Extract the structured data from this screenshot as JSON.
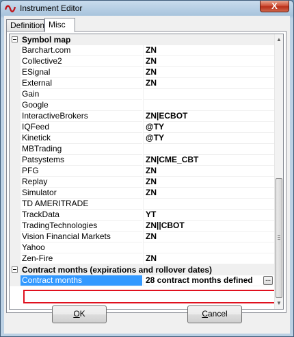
{
  "window": {
    "title": "Instrument Editor",
    "close_glyph": "X"
  },
  "tabs": [
    {
      "label": "Definition"
    },
    {
      "label": "Misc"
    }
  ],
  "categories": {
    "symbol_map": {
      "label": "Symbol map"
    },
    "contract_months": {
      "label": "Contract months (expirations and rollover dates)"
    }
  },
  "symbol_map": [
    {
      "name": "Barchart.com",
      "value": "ZN"
    },
    {
      "name": "Collective2",
      "value": "ZN"
    },
    {
      "name": "ESignal",
      "value": "ZN"
    },
    {
      "name": "External",
      "value": "ZN"
    },
    {
      "name": "Gain",
      "value": ""
    },
    {
      "name": "Google",
      "value": ""
    },
    {
      "name": "InteractiveBrokers",
      "value": "ZN|ECBOT"
    },
    {
      "name": "IQFeed",
      "value": "@TY"
    },
    {
      "name": "Kinetick",
      "value": "@TY"
    },
    {
      "name": "MBTrading",
      "value": ""
    },
    {
      "name": "Patsystems",
      "value": "ZN|CME_CBT"
    },
    {
      "name": "PFG",
      "value": "ZN"
    },
    {
      "name": "Replay",
      "value": "ZN"
    },
    {
      "name": "Simulator",
      "value": "ZN"
    },
    {
      "name": "TD AMERITRADE",
      "value": ""
    },
    {
      "name": "TrackData",
      "value": "YT"
    },
    {
      "name": "TradingTechnologies",
      "value": "ZN||CBOT"
    },
    {
      "name": "Vision Financial Markets",
      "value": "ZN"
    },
    {
      "name": "Yahoo",
      "value": ""
    },
    {
      "name": "Zen-Fire",
      "value": "ZN"
    }
  ],
  "contract_months": {
    "name": "Contract months",
    "value": "28 contract months defined",
    "ellipsis": "..."
  },
  "scrollbar": {
    "up": "▲",
    "down": "▼"
  },
  "buttons": {
    "ok": {
      "accel": "O",
      "rest": "K"
    },
    "cancel": {
      "accel": "C",
      "rest": "ancel"
    }
  }
}
